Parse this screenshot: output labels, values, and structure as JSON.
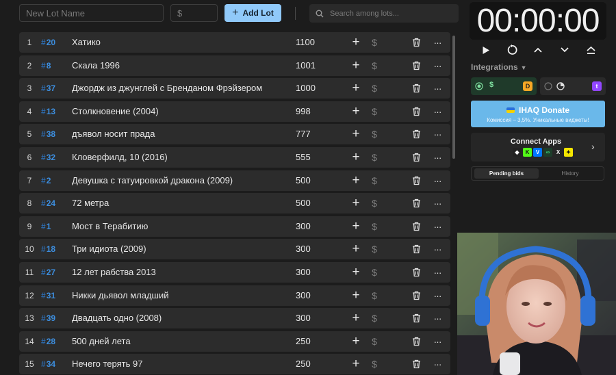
{
  "toolbar": {
    "lot_name_placeholder": "New Lot Name",
    "amount_placeholder": "$",
    "add_lot_label": "Add Lot",
    "search_placeholder": "Search among lots..."
  },
  "lots": [
    {
      "idx": "1",
      "num": "20",
      "name": "Хатико",
      "amount": "1100"
    },
    {
      "idx": "2",
      "num": "8",
      "name": "Скала 1996",
      "amount": "1001"
    },
    {
      "idx": "3",
      "num": "37",
      "name": "Джордж из джунглей с Бренданом Фрэйзером",
      "amount": "1000"
    },
    {
      "idx": "4",
      "num": "13",
      "name": "Столкновение (2004)",
      "amount": "998"
    },
    {
      "idx": "5",
      "num": "38",
      "name": "дъявол носит прада",
      "amount": "777"
    },
    {
      "idx": "6",
      "num": "32",
      "name": "Кловерфилд, 10 (2016)",
      "amount": "555"
    },
    {
      "idx": "7",
      "num": "2",
      "name": "Девушка с татуировкой дракона (2009)",
      "amount": "500"
    },
    {
      "idx": "8",
      "num": "24",
      "name": "72 метра",
      "amount": "500"
    },
    {
      "idx": "9",
      "num": "1",
      "name": "Мост в Терабитию",
      "amount": "300"
    },
    {
      "idx": "10",
      "num": "18",
      "name": "Три идиота (2009)",
      "amount": "300"
    },
    {
      "idx": "11",
      "num": "27",
      "name": "12 лет рабства 2013",
      "amount": "300"
    },
    {
      "idx": "12",
      "num": "31",
      "name": "Никки дьявол младший",
      "amount": "300"
    },
    {
      "idx": "13",
      "num": "39",
      "name": "Двадцать одно (2008)",
      "amount": "300"
    },
    {
      "idx": "14",
      "num": "28",
      "name": "500 дней лета",
      "amount": "250"
    },
    {
      "idx": "15",
      "num": "34",
      "name": "Нечего терять 97",
      "amount": "250"
    }
  ],
  "lot_row_symbols": {
    "hash": "#",
    "plus": "+",
    "dollar": "$",
    "more": "···"
  },
  "timer": {
    "display": "00:00:00"
  },
  "integrations": {
    "title": "Integrations",
    "da_symbol": "$"
  },
  "donate": {
    "title": "IHAQ Donate",
    "subtitle": "Комиссия – 3,5%. Уникальные виджеты!"
  },
  "connect_apps": {
    "title": "Connect Apps"
  },
  "bids": {
    "pending_label": "Pending bids",
    "history_label": "History"
  },
  "colors": {
    "accent": "#90c9f9",
    "lot_number": "#3d8fe0",
    "donate_bg": "#6ab8ea"
  }
}
